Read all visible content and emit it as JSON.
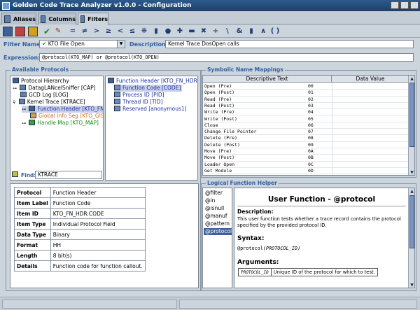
{
  "window": {
    "title": "Golden Code Trace Analyzer v1.0.0 - Configuration"
  },
  "tabs": [
    {
      "label": "Aliases"
    },
    {
      "label": "Columns"
    },
    {
      "label": "Filters"
    }
  ],
  "toolbar": {
    "buttons": [
      "grid-icon",
      "palette-icon",
      "chart-icon",
      "check-icon",
      "edit-icon",
      "equals-icon",
      "not-equals-icon",
      "greater-icon",
      "greater-equal-icon",
      "less-icon",
      "less-equal-icon",
      "and-icon",
      "or-icon",
      "not-icon",
      "plus-icon",
      "minus-icon",
      "multiply-icon",
      "divide-icon",
      "backslash-icon",
      "bitand-icon",
      "bitor-icon",
      "caret-icon",
      "parens-icon"
    ],
    "symbols": [
      "=",
      "≠",
      ">",
      "≥",
      "<",
      "≤",
      "❋",
      "▮",
      "●",
      "✚",
      "▬",
      "✖",
      "÷",
      "\\",
      "&",
      "▮",
      "∧",
      "( )"
    ]
  },
  "filter": {
    "name_label": "Filter Name:",
    "name_value": "KTO File Open",
    "description_label": "Description:",
    "description_value": "Kernel Trace DosOpen calls",
    "expression_label": "Expression:",
    "expression_value": "@protocol(KTO_MAP) or @protocol(KTO_OPEN)"
  },
  "protocols": {
    "title": "Available Protocols",
    "tree": [
      {
        "label": "Protocol Hierarchy",
        "color": "#000000"
      },
      {
        "label": "DatagLANcelSniffer [CAP]",
        "color": "#000000"
      },
      {
        "label": "GCD Log [LOG]",
        "color": "#000000"
      },
      {
        "label": "Kernel Trace [KTRACE]",
        "color": "#000000"
      },
      {
        "label": "Function Header [KTO_FN_",
        "color": "#1b2fa0"
      },
      {
        "label": "Global Info Seg [KTO_GIS",
        "color": "#d2691e"
      },
      {
        "label": "Handle Map [KTO_MAP]",
        "color": "#1e8a1e"
      }
    ],
    "fields": [
      {
        "label": "Function Header [KTO_FN_HDR]"
      },
      {
        "label": "Function Code [CODE]"
      },
      {
        "label": "Process ID [PID]"
      },
      {
        "label": "Thread ID [TID]"
      },
      {
        "label": "Reserved [anonymous1]"
      }
    ],
    "find_label": "Find:",
    "find_value": "KTRACE"
  },
  "properties": [
    {
      "key": "Protocol",
      "value": "Function Header"
    },
    {
      "key": "Item Label",
      "value": "Function Code"
    },
    {
      "key": "Item ID",
      "value": "KTO_FN_HDR:CODE"
    },
    {
      "key": "Item Type",
      "value": "Individual Protocol Field"
    },
    {
      "key": "Data Type",
      "value": "Binary"
    },
    {
      "key": "Format",
      "value": "HH"
    },
    {
      "key": "Length",
      "value": "8 bit(s)"
    },
    {
      "key": "Details",
      "value": "Function code for function callout."
    }
  ],
  "symbolic": {
    "title": "Symbolic Name Mappings",
    "col_text": "Descriptive Text",
    "col_value": "Data Value",
    "rows": [
      {
        "text": "Open (Pre)",
        "value": "00"
      },
      {
        "text": "Open (Post)",
        "value": "01"
      },
      {
        "text": "Read (Pre)",
        "value": "02"
      },
      {
        "text": "Read (Post)",
        "value": "03"
      },
      {
        "text": "Write (Pre)",
        "value": "04"
      },
      {
        "text": "Write (Post)",
        "value": "05"
      },
      {
        "text": "Close",
        "value": "06"
      },
      {
        "text": "Change File Pointer",
        "value": "07"
      },
      {
        "text": "Delete (Pre)",
        "value": "08"
      },
      {
        "text": "Delete (Post)",
        "value": "09"
      },
      {
        "text": "Move (Pre)",
        "value": "0A"
      },
      {
        "text": "Move (Post)",
        "value": "0B"
      },
      {
        "text": "Loader Open",
        "value": "0C"
      },
      {
        "text": "Get Module",
        "value": "0D"
      }
    ]
  },
  "helper": {
    "title": "Logical Function Helper",
    "functions": [
      "@filter",
      "@in",
      "@isnull",
      "@manuf",
      "@pattern",
      "@protocol"
    ],
    "doc_title": "User Function - @protocol",
    "description_label": "Description:",
    "description_text_1": "This user function tests whether a trace record contains the protocol",
    "description_text_2": "specified by the provided protocol ID.",
    "syntax_label": "Syntax:",
    "syntax_fn": "@protocol",
    "syntax_arg": "(PROTOCOL_ID)",
    "arguments_label": "Arguments:",
    "arg_name": "PROTOCOL_ID",
    "arg_desc": "Unique ID of the protocol for which to test."
  }
}
